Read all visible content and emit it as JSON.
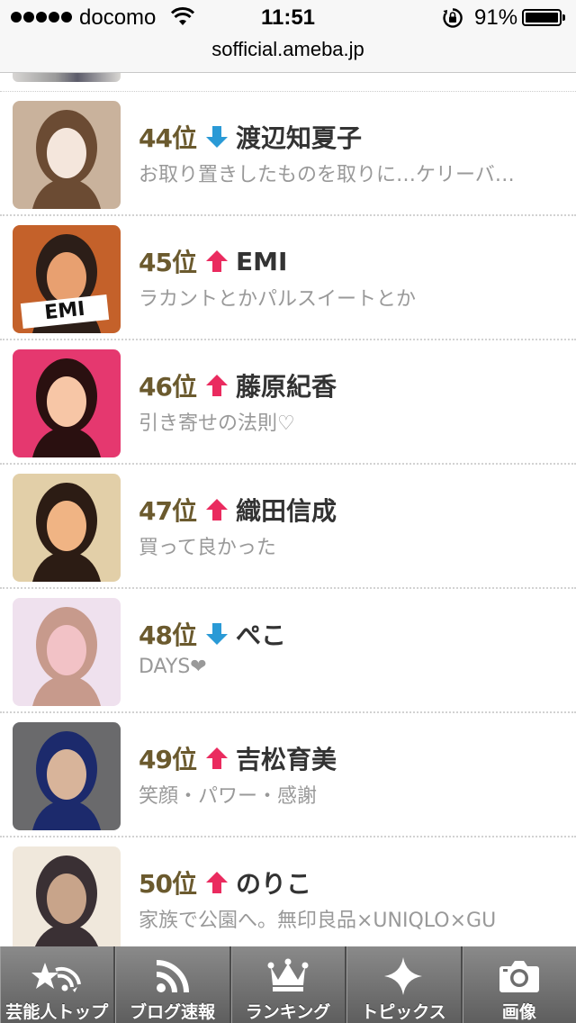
{
  "status_bar": {
    "carrier": "docomo",
    "time": "11:51",
    "battery": "91%",
    "signal_bars": 5,
    "battery_level": 0.91
  },
  "url_bar": {
    "url": "sofficial.ameba.jp"
  },
  "ranking": [
    {
      "rank": "44位",
      "trend": "down",
      "name": "渡辺知夏子",
      "desc": "お取り置きしたものを取りに…ケリーバ…",
      "colors": [
        "#c9b29c",
        "#f4e6dc",
        "#6b4b33"
      ]
    },
    {
      "rank": "45位",
      "trend": "up",
      "name": "EMI",
      "desc": "ラカントとかパルスイートとか",
      "badge": "EMI",
      "colors": [
        "#c4612a",
        "#e8a070",
        "#2c1e18"
      ]
    },
    {
      "rank": "46位",
      "trend": "up",
      "name": "藤原紀香",
      "desc": "引き寄せの法則♡",
      "colors": [
        "#e5386f",
        "#f7c6a6",
        "#2a1010"
      ]
    },
    {
      "rank": "47位",
      "trend": "up",
      "name": "織田信成",
      "desc": "買って良かった",
      "colors": [
        "#e2cfa8",
        "#f0b484",
        "#2c1c14"
      ]
    },
    {
      "rank": "48位",
      "trend": "down",
      "name": "ぺこ",
      "desc": "DAYS❤",
      "colors": [
        "#efe1ee",
        "#f2c2c6",
        "#c79a8c"
      ]
    },
    {
      "rank": "49位",
      "trend": "up",
      "name": "吉松育美",
      "desc": "笑顔・パワー・感謝",
      "colors": [
        "#6a6a6c",
        "#d8b49a",
        "#1c2a6c"
      ]
    },
    {
      "rank": "50位",
      "trend": "up",
      "name": "のりこ",
      "desc": "家族で公園へ。無印良品×UNIQLO×GU",
      "colors": [
        "#f0e8dc",
        "#c8a48a",
        "#3a3034"
      ]
    }
  ],
  "trend_colors": {
    "up": "#ea2b5f",
    "down": "#2a9ad6"
  },
  "tab_bar": {
    "tabs": [
      {
        "label": "芸能人トップ",
        "icon": "star-wifi-icon"
      },
      {
        "label": "ブログ速報",
        "icon": "rss-icon"
      },
      {
        "label": "ランキング",
        "icon": "crown-icon"
      },
      {
        "label": "トピックス",
        "icon": "sparkle-icon"
      },
      {
        "label": "画像",
        "icon": "camera-icon"
      }
    ]
  }
}
